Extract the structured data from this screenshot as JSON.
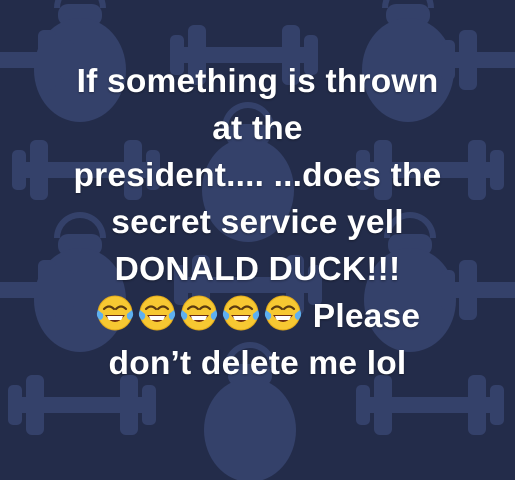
{
  "post": {
    "lines": [
      "If something is thrown",
      "at the",
      "president.... ...does the",
      "secret service yell",
      "DONALD DUCK!!!",
      "Please",
      "don’t delete me lol"
    ],
    "emoji": {
      "icon": "face-with-tears-of-joy-icon",
      "count": 5
    }
  },
  "background": {
    "color": "#232c4a",
    "pattern_color": "#34416a",
    "pattern_icons": [
      "kettlebell-icon",
      "dumbbell-icon"
    ]
  }
}
